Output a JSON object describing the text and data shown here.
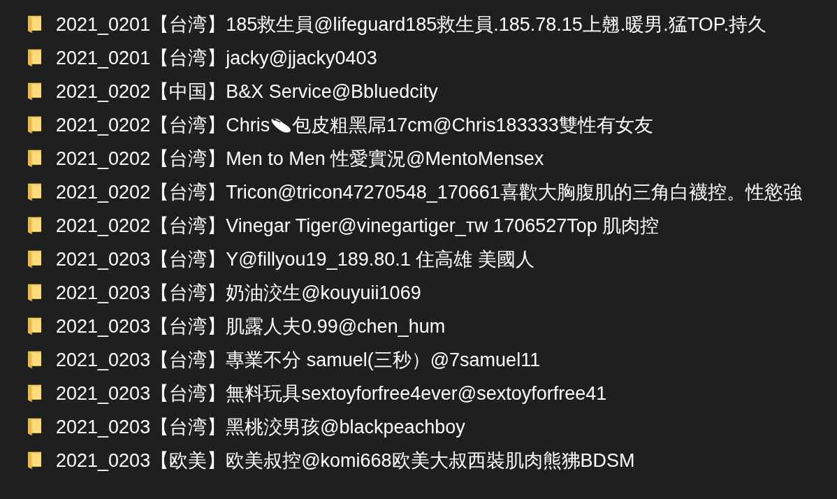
{
  "folders": [
    {
      "name": "2021_0201【台湾】185救生員@lifeguard185救生員.185.78.15上翹.暖男.猛TOP.持久"
    },
    {
      "name": "2021_0201【台湾】jacky@jjacky0403"
    },
    {
      "name": "2021_0202【中国】B&X Service@Bbluedcity"
    },
    {
      "name": "2021_0202【台湾】Chris",
      "name_after_icon": "包皮粗黑屌17cm@Chris183333雙性有女友"
    },
    {
      "name": "2021_0202【台湾】Men to Men 性愛實況@MentoMensex"
    },
    {
      "name": "2021_0202【台湾】Tricon@tricon47270548_170661喜歡大胸腹肌的三角白襪控。性慾強"
    },
    {
      "name": "2021_0202【台湾】Vinegar Tiger@vinegartiger_ᴛᴡ 1706527Top 肌肉控"
    },
    {
      "name": "2021_0203【台湾】Y@fillyou19_189.80.1 住高雄 美國人"
    },
    {
      "name": "2021_0203【台湾】奶油洨生@kouyuii1069"
    },
    {
      "name": "2021_0203【台湾】肌露人夫0.99@chen_hum"
    },
    {
      "name": "2021_0203【台湾】專業不分 samuel(三秒）@7samuel11"
    },
    {
      "name": "2021_0203【台湾】無料玩具sextoyforfree4ever@sextoyforfree41"
    },
    {
      "name": "2021_0203【台湾】黑桃洨男孩@blackpeachboy"
    },
    {
      "name": "2021_0203【欧美】欧美叔控@komi668欧美大叔西裝肌肉熊狒BDSM"
    }
  ]
}
